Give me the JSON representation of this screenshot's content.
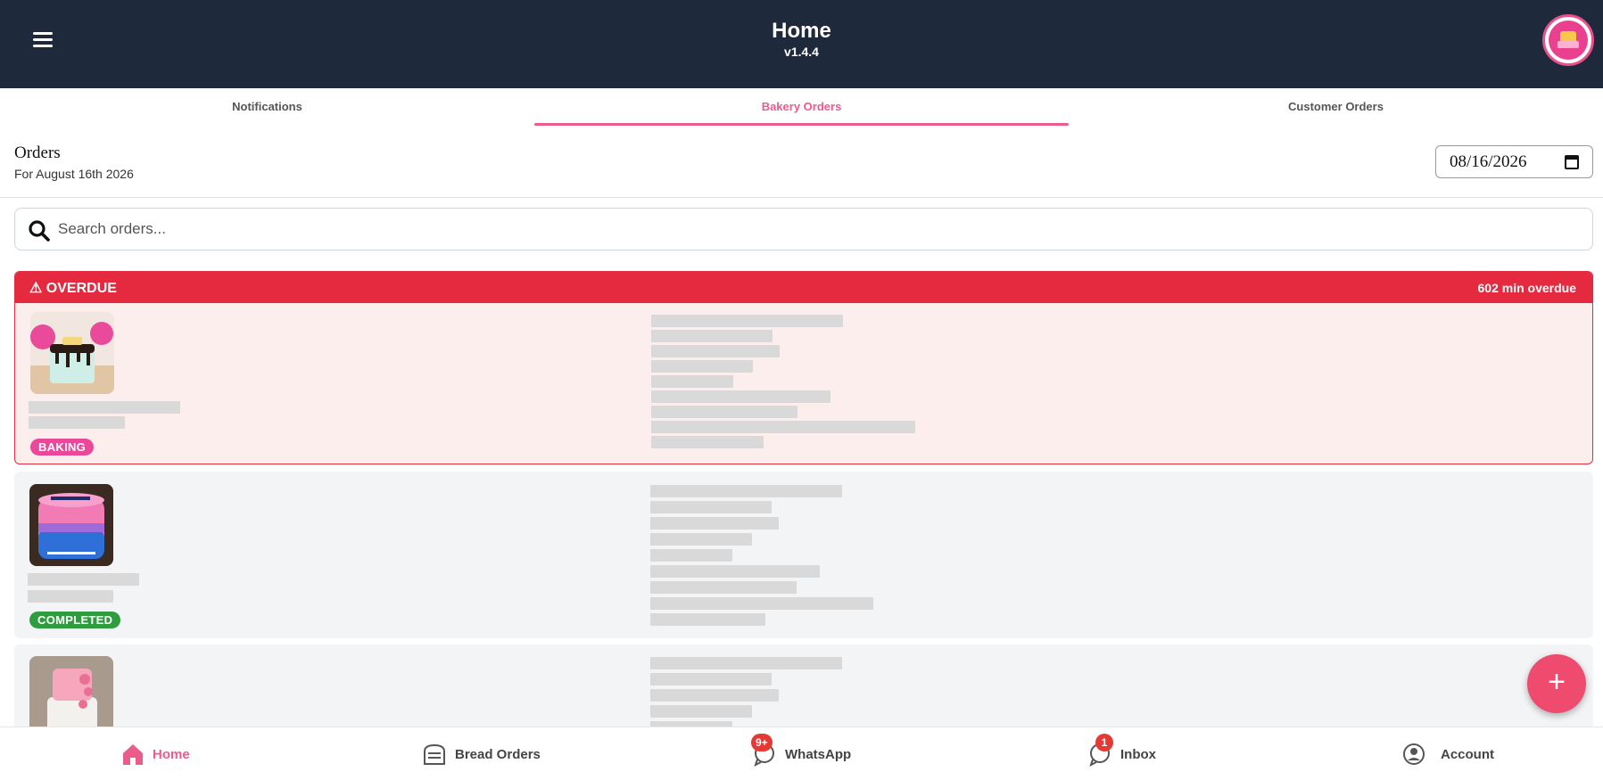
{
  "header": {
    "title": "Home",
    "version": "v1.4.4"
  },
  "tabs": [
    {
      "label": "Notifications",
      "active": false
    },
    {
      "label": "Bakery Orders",
      "active": true
    },
    {
      "label": "Customer Orders",
      "active": false
    }
  ],
  "orders": {
    "title": "Orders",
    "subtitle": "For August 16th 2026",
    "date_value": "08/16/2026"
  },
  "search": {
    "placeholder": "Search orders..."
  },
  "cards": [
    {
      "overdue_label": "⚠ OVERDUE",
      "overdue_time": "602 min overdue",
      "status": "BAKING",
      "status_color": "#ec4899"
    },
    {
      "status": "COMPLETED",
      "status_color": "#2f9d3f"
    },
    {
      "status": ""
    }
  ],
  "bottom_nav": {
    "home": "Home",
    "bread_orders": "Bread Orders",
    "whatsapp": "WhatsApp",
    "whatsapp_count": "9+",
    "inbox": "Inbox",
    "inbox_count": "1",
    "account": "Account"
  },
  "colors": {
    "header_bg": "#1e293b",
    "accent": "#ec5c8a",
    "overdue": "#e52a3f",
    "fab": "#ee4b6e"
  }
}
